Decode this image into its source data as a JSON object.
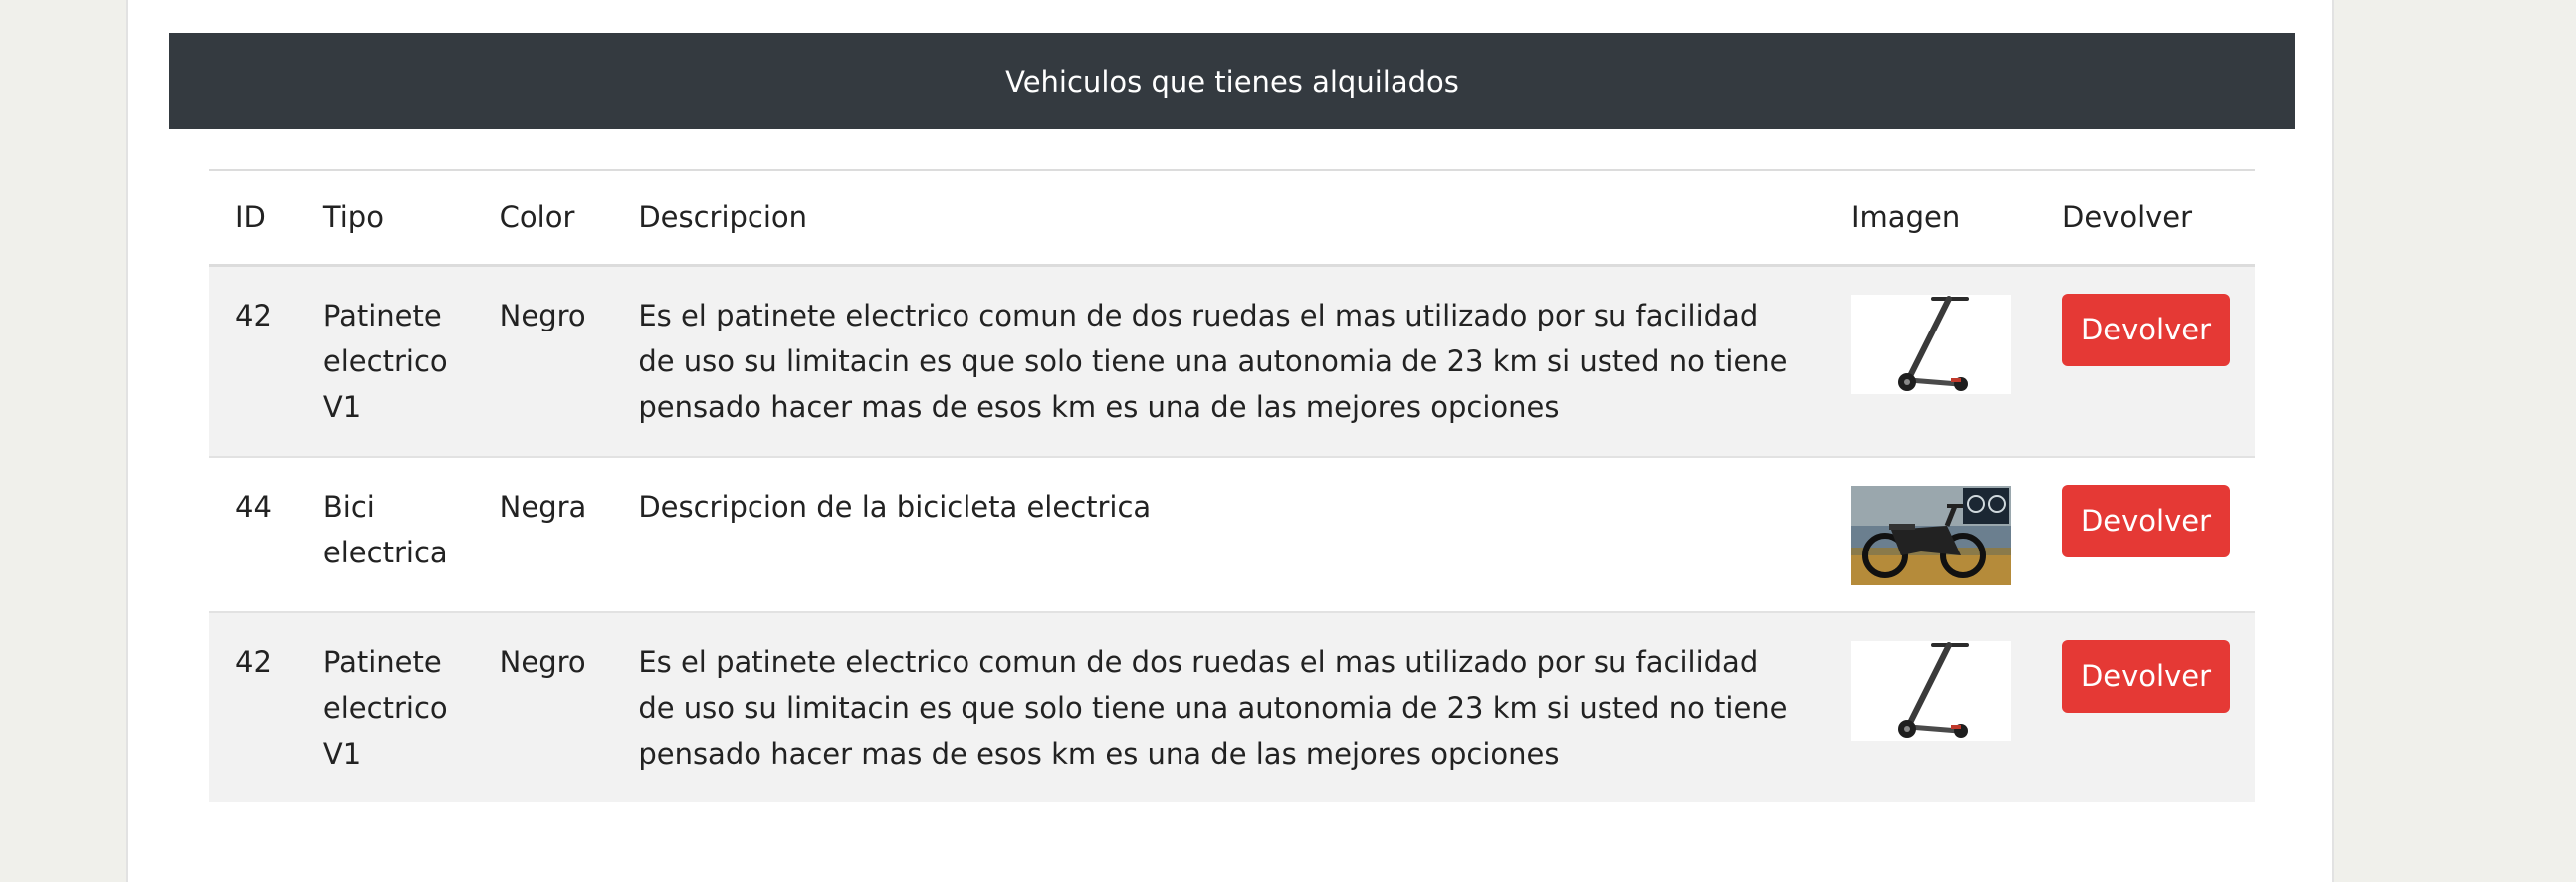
{
  "page": {
    "title": "Vehiculos que tienes alquilados"
  },
  "table": {
    "headers": {
      "id": "ID",
      "tipo": "Tipo",
      "color": "Color",
      "descripcion": "Descripcion",
      "imagen": "Imagen",
      "devolver": "Devolver"
    },
    "rows": [
      {
        "id": "42",
        "tipo": "Patinete electrico V1",
        "color": "Negro",
        "descripcion": "Es el patinete electrico comun de dos ruedas el mas utilizado por su facilidad de uso su limitacin es que solo tiene una autonomia de 23 km si usted no tiene pensado hacer mas de esos km es una de las mejores opciones",
        "image": "scooter-photo",
        "button_label": "Devolver"
      },
      {
        "id": "44",
        "tipo": "Bici electrica",
        "color": "Negra",
        "descripcion": "Descripcion de la bicicleta electrica",
        "image": "ebike-photo",
        "button_label": "Devolver"
      },
      {
        "id": "42",
        "tipo": "Patinete electrico V1",
        "color": "Negro",
        "descripcion": "Es el patinete electrico comun de dos ruedas el mas utilizado por su facilidad de uso su limitacin es que solo tiene una autonomia de 23 km si usted no tiene pensado hacer mas de esos km es una de las mejores opciones",
        "image": "scooter-photo",
        "button_label": "Devolver"
      }
    ]
  },
  "colors": {
    "header_bg": "#343a40",
    "button_bg": "#e53935",
    "stripe_bg": "#f2f2f2"
  }
}
